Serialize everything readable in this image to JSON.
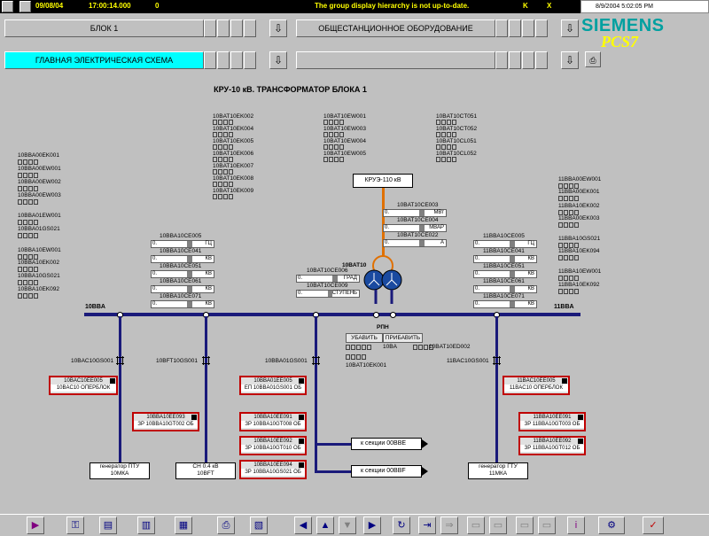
{
  "topbar": {
    "date": "09/08/04",
    "time": "17:00:14.000",
    "counter": "0",
    "message": "The group display hierarchy is not up-to-date.",
    "k_label": "K",
    "x_label": "X"
  },
  "datetime": "8/9/2004 5:02:05 PM",
  "header": {
    "field1": "БЛОК 1",
    "field2": "ОБЩЕСТАНЦИОННОЕ ОБОРУДОВАНИЕ",
    "field3": "ГЛАВНАЯ ЭЛЕКТРИЧЕСКАЯ СХЕМА",
    "field4": ""
  },
  "logo": {
    "brand": "SIEMENS",
    "product": "PCS7"
  },
  "title": "КРУ-10 кВ. ТРАНСФОРМАТОР БЛОКА 1",
  "left_tags": [
    "10BBA00EK001",
    "10BBA00EW001",
    "10BBA00EW002",
    "10BBA00EW003",
    "10BBA01EW001",
    "10BBA01GS021",
    "10BBA10EW001",
    "10BBA10EK002",
    "10BBA10GS021",
    "10BBA10EK092"
  ],
  "top_tags_1": [
    "10BAT10EK002",
    "10BAT10EK004",
    "10BAT10EK005",
    "10BAT10EK006",
    "10BAT10EK007",
    "10BAT10EK008",
    "10BAT10EK009"
  ],
  "top_tags_2": [
    "10BAT10EW001",
    "10BAT10EW003",
    "10BAT10EW004",
    "10BAT10EW005"
  ],
  "top_tags_3": [
    "10BAT10CT051",
    "10BAT10CT052",
    "10BAT10CL051",
    "10BAT10CL052"
  ],
  "right_tags": [
    "11BBA00EW001",
    "11BBA00EK001",
    "11BBA10EK002",
    "11BBA00EK003",
    "11BBA10GS021",
    "11BBA10EK094",
    "11BBA10EW001",
    "11BBA10EK092"
  ],
  "kru": "КРУЭ-110 кВ",
  "trafo_meas": [
    {
      "tag": "10BAT10CE003",
      "value": "0.",
      "unit": "МВт"
    },
    {
      "tag": "10BAT10CE004",
      "value": "0.",
      "unit": "МВАР"
    },
    {
      "tag": "10BAT10CE022",
      "value": "0.",
      "unit": "А"
    }
  ],
  "trafo_name": "10BAT10",
  "trafo_ang": [
    {
      "tag": "10BAT10CE006",
      "value": "0.",
      "unit": "ГРАД"
    },
    {
      "tag": "10BAT10CE009",
      "value": "0.",
      "unit": "СТУПЕНЬ"
    }
  ],
  "left_meas": [
    {
      "tag": "10BBA10CE005",
      "value": "0.",
      "unit": "ГЦ"
    },
    {
      "tag": "10BBA10CE041",
      "value": "0.",
      "unit": "КВ"
    },
    {
      "tag": "10BBA10CE051",
      "value": "0.",
      "unit": "КВ"
    },
    {
      "tag": "10BBA10CE061",
      "value": "0.",
      "unit": "КВ"
    },
    {
      "tag": "10BBA10CE071",
      "value": "0.",
      "unit": "КВ"
    }
  ],
  "right_meas": [
    {
      "tag": "11BBA10CE005",
      "value": "0.",
      "unit": "ГЦ"
    },
    {
      "tag": "11BBA10CE041",
      "value": "0.",
      "unit": "КВ"
    },
    {
      "tag": "11BBA10CE051",
      "value": "0.",
      "unit": "КВ"
    },
    {
      "tag": "11BBA10CE061",
      "value": "0.",
      "unit": "КВ"
    },
    {
      "tag": "11BBA10CE071",
      "value": "0.",
      "unit": "КВ"
    }
  ],
  "bus_left": "10BBA",
  "bus_right": "11BBA",
  "rpn": "РПН",
  "btn_reduce": "УБАВИТЬ",
  "btn_add": "ПРИБАВИТЬ",
  "tag_10ba": "10BA",
  "tag_10bat10ed002": "10BAT10ED002",
  "tag_10bat10ek001": "10BAT10EK001",
  "feeders": {
    "f1_breaker": "10BAC10GS001",
    "f2_breaker": "10BFT10GS001",
    "f3_breaker": "10BBA01GS001",
    "f4_breaker": "11BAC10GS001"
  },
  "devboxes": {
    "d1": {
      "t1": "10BAC10EE005",
      "t2": "10BAC10 ОПЕРБЛОК"
    },
    "d2": {
      "t1": "10BBA10EE093",
      "t2": "ЗР 10BBA10GT002 ОБ"
    },
    "d3": {
      "t1": "10BBA01EE005",
      "t2": "ЕП 10BBA01GS001 ОБ"
    },
    "d4": {
      "t1": "10BBA10EE091",
      "t2": "ЗР 10BBA10GT008 ОБ"
    },
    "d5": {
      "t1": "10BBA10EE092",
      "t2": "ЗР 10BBA10GT010 ОБ"
    },
    "d6": {
      "t1": "10BBA10EE094",
      "t2": "ЗР 10BBA10GS021 ОБ"
    },
    "d7": {
      "t1": "11BAC10EE005",
      "t2": "11BAC10 ОПЕРБЛОК"
    },
    "d8": {
      "t1": "11BBA10EE091",
      "t2": "ЗР 11BBA10GT003 ОБ"
    },
    "d9": {
      "t1": "11BBA10EE092",
      "t2": "ЗР 11BBA10GT012 ОБ"
    }
  },
  "sections": {
    "s1": "к секции 00BBE",
    "s2": "к секции 00BBF"
  },
  "loads": {
    "l1": {
      "a": "генератор ПТУ",
      "b": "10МКА"
    },
    "l2": {
      "a": "СН 0.4 кВ",
      "b": "10BFT"
    },
    "l3": {
      "a": "генератор ГТУ",
      "b": "11МКА"
    }
  },
  "colors": {
    "bus": "#1a1a7a",
    "accent": "#00ffff",
    "alarm": "#c00000",
    "transformer_feed": "#e07000"
  }
}
